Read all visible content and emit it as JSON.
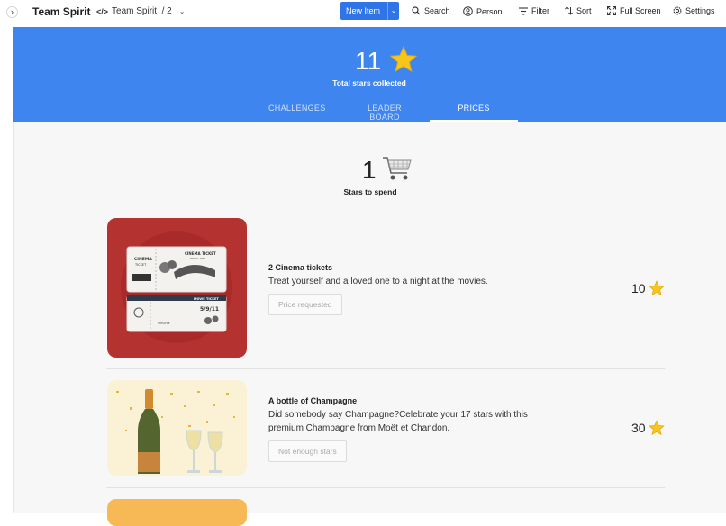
{
  "app": {
    "title": "Team Spirit",
    "breadcrumb": "Team Spirit  / 2",
    "breadcrumb_icon": "code-icon"
  },
  "toolbar": {
    "new_item": "New Item",
    "search": "Search",
    "person": "Person",
    "filter": "Filter",
    "sort": "Sort",
    "fullscreen": "Full Screen",
    "settings": "Settings"
  },
  "hero": {
    "total_stars": "11",
    "total_label": "Total stars collected",
    "tabs": [
      {
        "label": "CHALLENGES"
      },
      {
        "label": "LEADER BOARD"
      },
      {
        "label": "PRICES"
      }
    ],
    "active_tab": "PRICES"
  },
  "spend": {
    "count": "1",
    "label": "Stars to spend"
  },
  "items": [
    {
      "title": "2 Cinema tickets",
      "description": "Treat yourself and a loved one to a night at the movies.",
      "button": "Price requested",
      "price": "10",
      "ticket_text": {
        "cinema": "CINEMA",
        "ticket": "TICKET",
        "cinema_ticket": "CINEMA TICKET",
        "admit_one": "ADMIT ONE",
        "movie_ticket": "MOVIE TICKET",
        "date": "5/9/11",
        "theatre": "THEATRE"
      }
    },
    {
      "title": "A bottle of Champagne",
      "description": "Did somebody say Champagne?Celebrate your 17 stars with this premium Champagne from Moët et Chandon.",
      "button": "Not enough stars",
      "price": "30"
    }
  ],
  "colors": {
    "accent": "#3e85f0",
    "button": "#2f75e8",
    "star": "#f5c518",
    "cinema_bg": "#b4322f",
    "champagne_bg": "#fbf2d6",
    "third_card": "#f7b955"
  }
}
